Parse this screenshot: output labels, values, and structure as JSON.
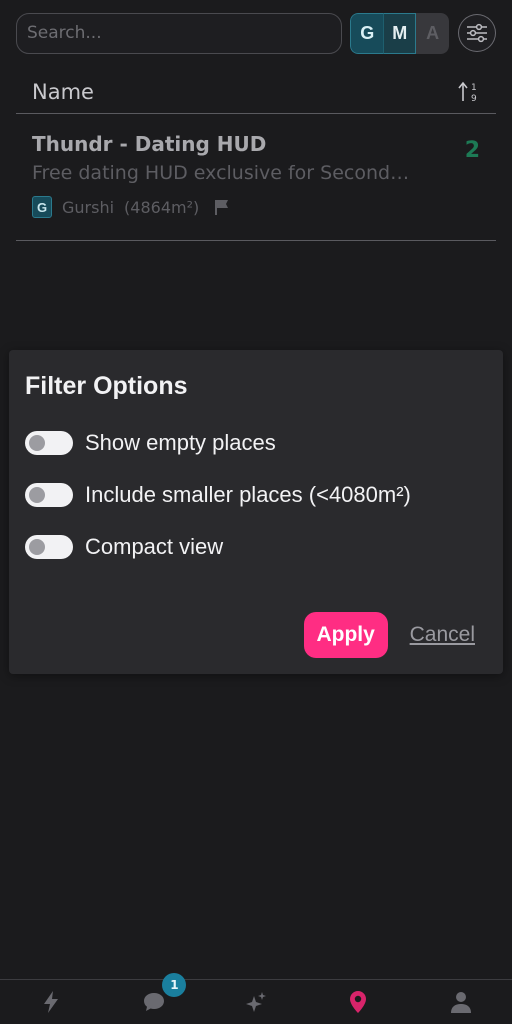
{
  "search": {
    "placeholder": "Search..."
  },
  "rating_filter": {
    "g": "G",
    "m": "M",
    "a": "A"
  },
  "list_header": {
    "column": "Name"
  },
  "places": [
    {
      "title": "Thundr - Dating HUD",
      "description": "Free dating HUD exclusive for Second Life",
      "count": "2",
      "rating": "G",
      "owner": "Gurshi",
      "area": "(4864m²)"
    }
  ],
  "filter_dialog": {
    "title": "Filter Options",
    "options": [
      {
        "label": "Show empty places",
        "enabled": false
      },
      {
        "label": "Include smaller places (<4080m²)",
        "enabled": false
      },
      {
        "label": "Compact view",
        "enabled": false
      }
    ],
    "apply_label": "Apply",
    "cancel_label": "Cancel"
  },
  "bottom_nav": {
    "items": [
      {
        "icon": "bolt-icon"
      },
      {
        "icon": "chat-icon",
        "badge": "1"
      },
      {
        "icon": "sparkles-icon"
      },
      {
        "icon": "map-pin-icon",
        "active": true
      },
      {
        "icon": "user-icon"
      }
    ]
  },
  "colors": {
    "accent": "#ff2d83",
    "active_nav": "#d8246a",
    "count": "#1d7a55",
    "rating_g": "#174b5a"
  }
}
